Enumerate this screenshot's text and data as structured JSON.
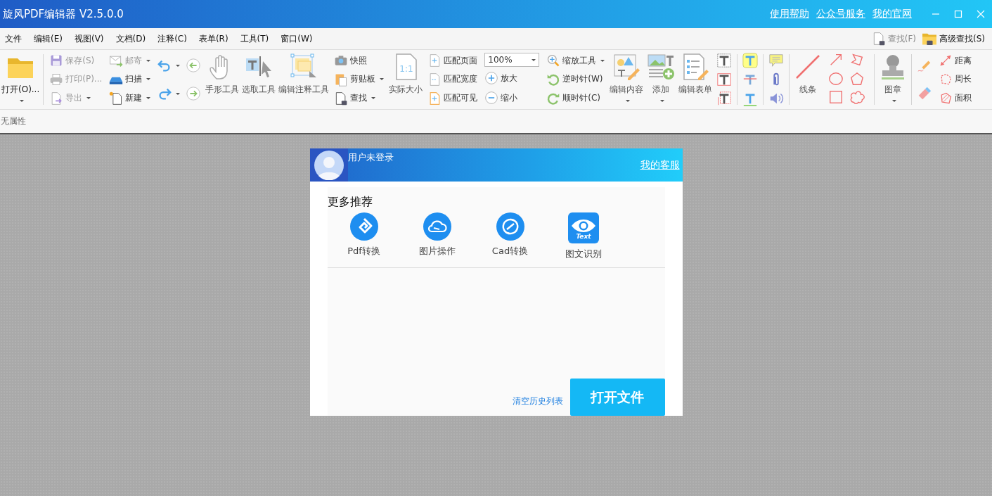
{
  "window": {
    "title": "旋风PDF编辑器 V2.5.0.0",
    "links": [
      "使用帮助",
      "公众号服务",
      "我的官网"
    ]
  },
  "menu": [
    {
      "label": "文件"
    },
    {
      "label": "编辑(E)"
    },
    {
      "label": "视图(V)"
    },
    {
      "label": "文档(D)"
    },
    {
      "label": "注释(C)"
    },
    {
      "label": "表单(R)"
    },
    {
      "label": "工具(T)"
    },
    {
      "label": "窗口(W)"
    }
  ],
  "quick_find": [
    {
      "label": "查找(F)",
      "disabled": true
    },
    {
      "label": "高级查找(S)",
      "disabled": false
    }
  ],
  "ribbon": [
    {
      "groups": [
        {
          "kind": "large",
          "items": [
            {
              "label": "打开(O)...",
              "disabled": false,
              "dropdown": true
            }
          ]
        }
      ]
    },
    {
      "groups": [
        {
          "kind": "stack",
          "items": [
            {
              "label": "保存(S)",
              "disabled": true,
              "dropdown": false
            },
            {
              "label": "打印(P)...",
              "disabled": true,
              "dropdown": false
            },
            {
              "label": "导出",
              "disabled": true,
              "dropdown": true
            }
          ]
        },
        {
          "kind": "stack",
          "items": [
            {
              "label": "邮寄",
              "disabled": true,
              "dropdown": true
            },
            {
              "label": "扫描",
              "disabled": false,
              "dropdown": true
            },
            {
              "label": "新建",
              "disabled": false,
              "dropdown": true
            }
          ]
        },
        {
          "kind": "icons",
          "items": [
            {
              "dropdown": true
            },
            {
              "dropdown": true
            }
          ]
        },
        {
          "kind": "icons",
          "items": [
            {
              "dropdown": false
            },
            {
              "dropdown": false
            }
          ]
        },
        {
          "kind": "large",
          "items": [
            {
              "label": "手形工具",
              "disabled": false,
              "dropdown": false
            },
            {
              "label": "选取工具",
              "disabled": false,
              "dropdown": false
            },
            {
              "label": "编辑注释工具",
              "disabled": false,
              "dropdown": false
            }
          ]
        },
        {
          "kind": "stack",
          "items": [
            {
              "label": "快照",
              "disabled": false,
              "dropdown": false
            },
            {
              "label": "剪贴板",
              "disabled": false,
              "dropdown": true
            },
            {
              "label": "查找",
              "disabled": false,
              "dropdown": true
            }
          ]
        },
        {
          "kind": "large",
          "items": [
            {
              "label": "实际大小",
              "disabled": false,
              "dropdown": false,
              "icon_text": "1:1"
            }
          ]
        },
        {
          "kind": "stack",
          "items": [
            {
              "label": "匹配页面",
              "disabled": false,
              "dropdown": false
            },
            {
              "label": "匹配宽度",
              "disabled": false,
              "dropdown": false
            },
            {
              "label": "匹配可见",
              "disabled": false,
              "dropdown": false
            }
          ]
        },
        {
          "kind": "stack",
          "items": [
            {
              "kind": "combo",
              "value": "100%"
            },
            {
              "kind": "button",
              "label": "放大",
              "disabled": false,
              "dropdown": false
            },
            {
              "kind": "button",
              "label": "缩小",
              "disabled": false,
              "dropdown": false
            }
          ]
        },
        {
          "kind": "stack",
          "items": [
            {
              "label": "缩放工具",
              "disabled": false,
              "dropdown": true
            },
            {
              "label": "逆时针(W)",
              "disabled": false,
              "dropdown": false
            },
            {
              "label": "顺时针(C)",
              "disabled": false,
              "dropdown": false
            }
          ]
        },
        {
          "kind": "large",
          "items": [
            {
              "label": "编辑内容",
              "disabled": false,
              "dropdown": true
            },
            {
              "label": "添加",
              "disabled": false,
              "dropdown": true
            },
            {
              "label": "编辑表单",
              "disabled": false,
              "dropdown": false
            }
          ]
        },
        {
          "kind": "icons",
          "items": [
            {
              "dropdown": false
            },
            {
              "dropdown": false
            },
            {
              "dropdown": false
            }
          ]
        }
      ]
    },
    {
      "groups": [
        {
          "kind": "icons",
          "items": [
            {
              "dropdown": false
            },
            {
              "dropdown": false
            },
            {
              "dropdown": false
            }
          ]
        }
      ]
    },
    {
      "groups": [
        {
          "kind": "icons",
          "items": [
            {
              "dropdown": false
            },
            {
              "dropdown": false
            },
            {
              "dropdown": false
            }
          ]
        }
      ]
    },
    {
      "groups": [
        {
          "kind": "large",
          "items": [
            {
              "label": "线条",
              "disabled": false,
              "dropdown": false
            }
          ]
        },
        {
          "kind": "grid",
          "items": [
            {
              "dropdown": false
            },
            {
              "dropdown": false
            },
            {
              "dropdown": false
            },
            {
              "dropdown": false
            },
            {
              "dropdown": false
            },
            {
              "dropdown": false
            }
          ]
        }
      ]
    },
    {
      "groups": [
        {
          "kind": "large",
          "items": [
            {
              "label": "图章",
              "disabled": false,
              "dropdown": true
            }
          ]
        }
      ]
    },
    {
      "groups": [
        {
          "kind": "icons",
          "items": [
            {
              "dropdown": false
            },
            {
              "dropdown": false
            }
          ]
        },
        {
          "kind": "stack",
          "items": [
            {
              "label": "距离",
              "disabled": false,
              "dropdown": false
            },
            {
              "label": "周长",
              "disabled": false,
              "dropdown": false
            },
            {
              "label": "面积",
              "disabled": false,
              "dropdown": false
            }
          ]
        }
      ]
    }
  ],
  "properties": {
    "text": "无属性"
  },
  "dialog": {
    "user": "用户未登录",
    "service_link": "我的客服",
    "section_title": "更多推荐",
    "apps": [
      {
        "label": "Pdf转换"
      },
      {
        "label": "图片操作"
      },
      {
        "label": "Cad转换"
      },
      {
        "label": "图文识别",
        "icon_text": "Text"
      }
    ],
    "clear_link": "清空历史列表",
    "open_button": "打开文件"
  }
}
